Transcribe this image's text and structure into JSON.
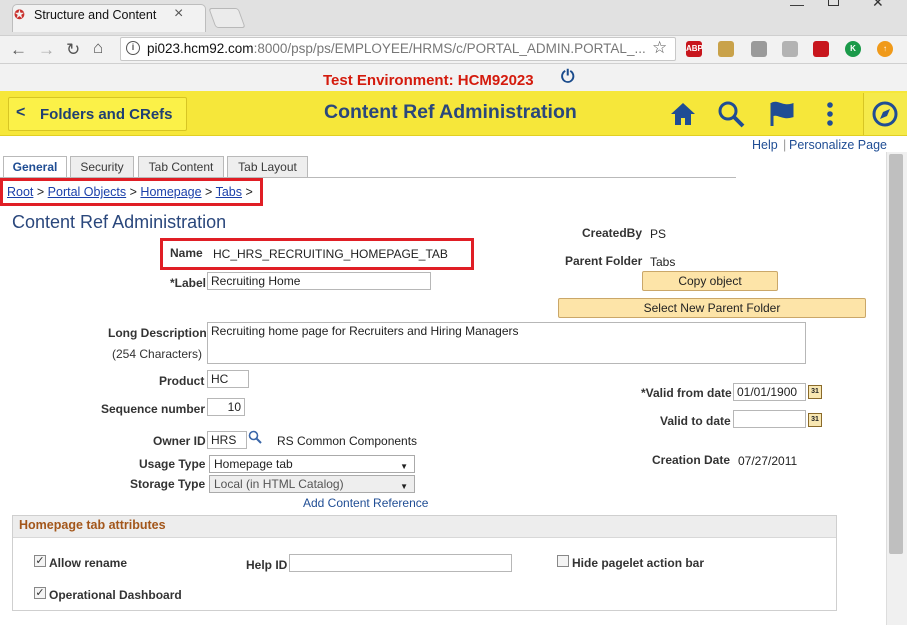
{
  "browser": {
    "tab_title": "Structure and Content",
    "url_host": "pi023.hcm92.com",
    "url_rest": ":8000/psp/ps/EMPLOYEE/HRMS/c/PORTAL_ADMIN.PORTAL_...",
    "extensions": [
      {
        "name": "adblock-icon",
        "text": "ABP",
        "color": "#c8161d"
      },
      {
        "name": "cookie-icon",
        "text": "",
        "color": "#c9a24a"
      },
      {
        "name": "cube-icon",
        "text": "",
        "color": "#9a9a9a"
      },
      {
        "name": "pdf-icon",
        "text": "",
        "color": "#b3b3b3"
      },
      {
        "name": "bookmark-red-icon",
        "text": "",
        "color": "#c8161d"
      },
      {
        "name": "k-icon",
        "text": "K",
        "color": "#1b9a4a"
      },
      {
        "name": "upload-icon",
        "text": "↑",
        "color": "#f09a1a"
      }
    ]
  },
  "env": {
    "label": "Test Environment: HCM92023"
  },
  "banner": {
    "back_label": "Folders and CRefs",
    "title": "Content Ref Administration"
  },
  "links": {
    "help": "Help",
    "personalize": "Personalize Page"
  },
  "tabs": [
    "General",
    "Security",
    "Tab Content",
    "Tab Layout"
  ],
  "breadcrumb": {
    "items": [
      "Root",
      "Portal Objects",
      "Homepage",
      "Tabs"
    ],
    "sep": " > "
  },
  "section_title": "Content Ref Administration",
  "form": {
    "name_label": "Name",
    "name_value": "HC_HRS_RECRUITING_HOMEPAGE_TAB",
    "label_label": "*Label",
    "label_value": "Recruiting Home",
    "long_desc_label": "Long Description",
    "long_desc_sub": "(254 Characters)",
    "long_desc_value": "Recruiting home page for Recruiters and Hiring Managers",
    "product_label": "Product",
    "product_value": "HC",
    "seq_label": "Sequence number",
    "seq_value": "10",
    "owner_label": "Owner ID",
    "owner_value": "HRS",
    "owner_desc": "RS Common Components",
    "usage_label": "Usage Type",
    "usage_value": "Homepage tab",
    "storage_label": "Storage Type",
    "storage_value": "Local (in HTML Catalog)",
    "add_ref": "Add Content Reference",
    "createdby_label": "CreatedBy",
    "createdby_value": "PS",
    "parent_label": "Parent Folder",
    "parent_value": "Tabs",
    "copy_btn": "Copy object",
    "select_parent_btn": "Select New Parent Folder",
    "valid_from_label": "*Valid from date",
    "valid_from_value": "01/01/1900",
    "valid_to_label": "Valid to date",
    "valid_to_value": "",
    "creation_label": "Creation Date",
    "creation_value": "07/27/2011",
    "cal_text": "31"
  },
  "group": {
    "title": "Homepage tab attributes",
    "allow_rename": "Allow rename",
    "operational_dashboard": "Operational Dashboard",
    "help_id_label": "Help ID",
    "help_id_value": "",
    "hide_pagelet": "Hide pagelet action bar"
  },
  "colors": {
    "banner": "#f6e73a",
    "accent": "#1f4d94",
    "highlight": "#e01e25"
  }
}
